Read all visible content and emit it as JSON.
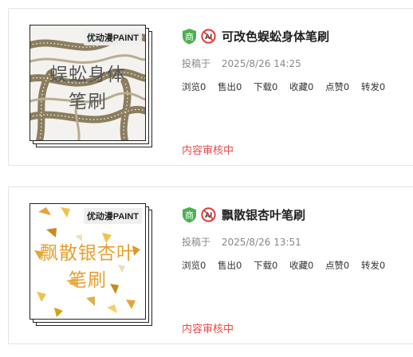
{
  "items": [
    {
      "badge": "优动漫PAINT",
      "watermark_line1": "蜈蚣身体",
      "watermark_line2": "笔刷",
      "title": "可改色蜈蚣身体笔刷",
      "publish_label": "投稿于",
      "publish_time": "2025/8/26 14:25",
      "stats": {
        "views": "浏览0",
        "sold": "售出0",
        "downloads": "下载0",
        "favorites": "收藏0",
        "likes": "点赞0",
        "shares": "转发0"
      },
      "status": "内容审核中",
      "icons": [
        "shop-shield-icon",
        "ai-no-icon"
      ]
    },
    {
      "badge": "优动漫PAINT",
      "watermark_line1": "飘散银杏叶",
      "watermark_line2": "笔刷",
      "title": "飘散银杏叶笔刷",
      "publish_label": "投稿于",
      "publish_time": "2025/8/26 13:51",
      "stats": {
        "views": "浏览0",
        "sold": "售出0",
        "downloads": "下载0",
        "favorites": "收藏0",
        "likes": "点赞0",
        "shares": "转发0"
      },
      "status": "内容审核中",
      "icons": [
        "shop-shield-icon",
        "ai-no-icon"
      ]
    }
  ],
  "icon_labels": {
    "shop": "商",
    "ai": "AI"
  },
  "colors": {
    "status_red": "#e94a4a",
    "shop_green": "#4caf50",
    "ai_red": "#e53935"
  }
}
